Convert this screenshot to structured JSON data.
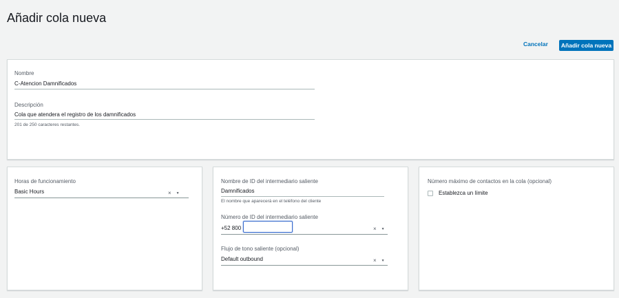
{
  "page": {
    "title": "Añadir cola nueva"
  },
  "actions": {
    "cancel_label": "Cancelar",
    "submit_label": "Añadir cola nueva"
  },
  "general": {
    "name_label": "Nombre",
    "name_value": "C-Atencion Damnificados",
    "description_label": "Descripción",
    "description_value": "Cola que atendera el registro de los damnificados",
    "description_help": "201 de 250 caracteres restantes."
  },
  "hours": {
    "label": "Horas de funcionamiento",
    "value": "Basic Hours"
  },
  "outbound": {
    "caller_id_name_label": "Nombre de ID del intermediario saliente",
    "caller_id_name_value": "Damnificados",
    "caller_id_name_help": "El nombre que aparecerá en el teléfono del cliente",
    "caller_id_number_label": "Número de ID del intermediario saliente",
    "caller_id_number_prefix": "+52 800",
    "whisper_label": "Flujo de tono saliente (opcional)",
    "whisper_value": "Default outbound"
  },
  "max_contacts": {
    "label": "Número máximo de contactos en la cola (opcional)",
    "checkbox_label": "Establezca un límite"
  },
  "icons": {
    "clear": "clear-x-icon",
    "dropdown": "caret-down-icon"
  },
  "colors": {
    "primary": "#0073bb",
    "link": "#0073bb",
    "focus": "#3c6ecf",
    "background": "#f2f3f3"
  }
}
